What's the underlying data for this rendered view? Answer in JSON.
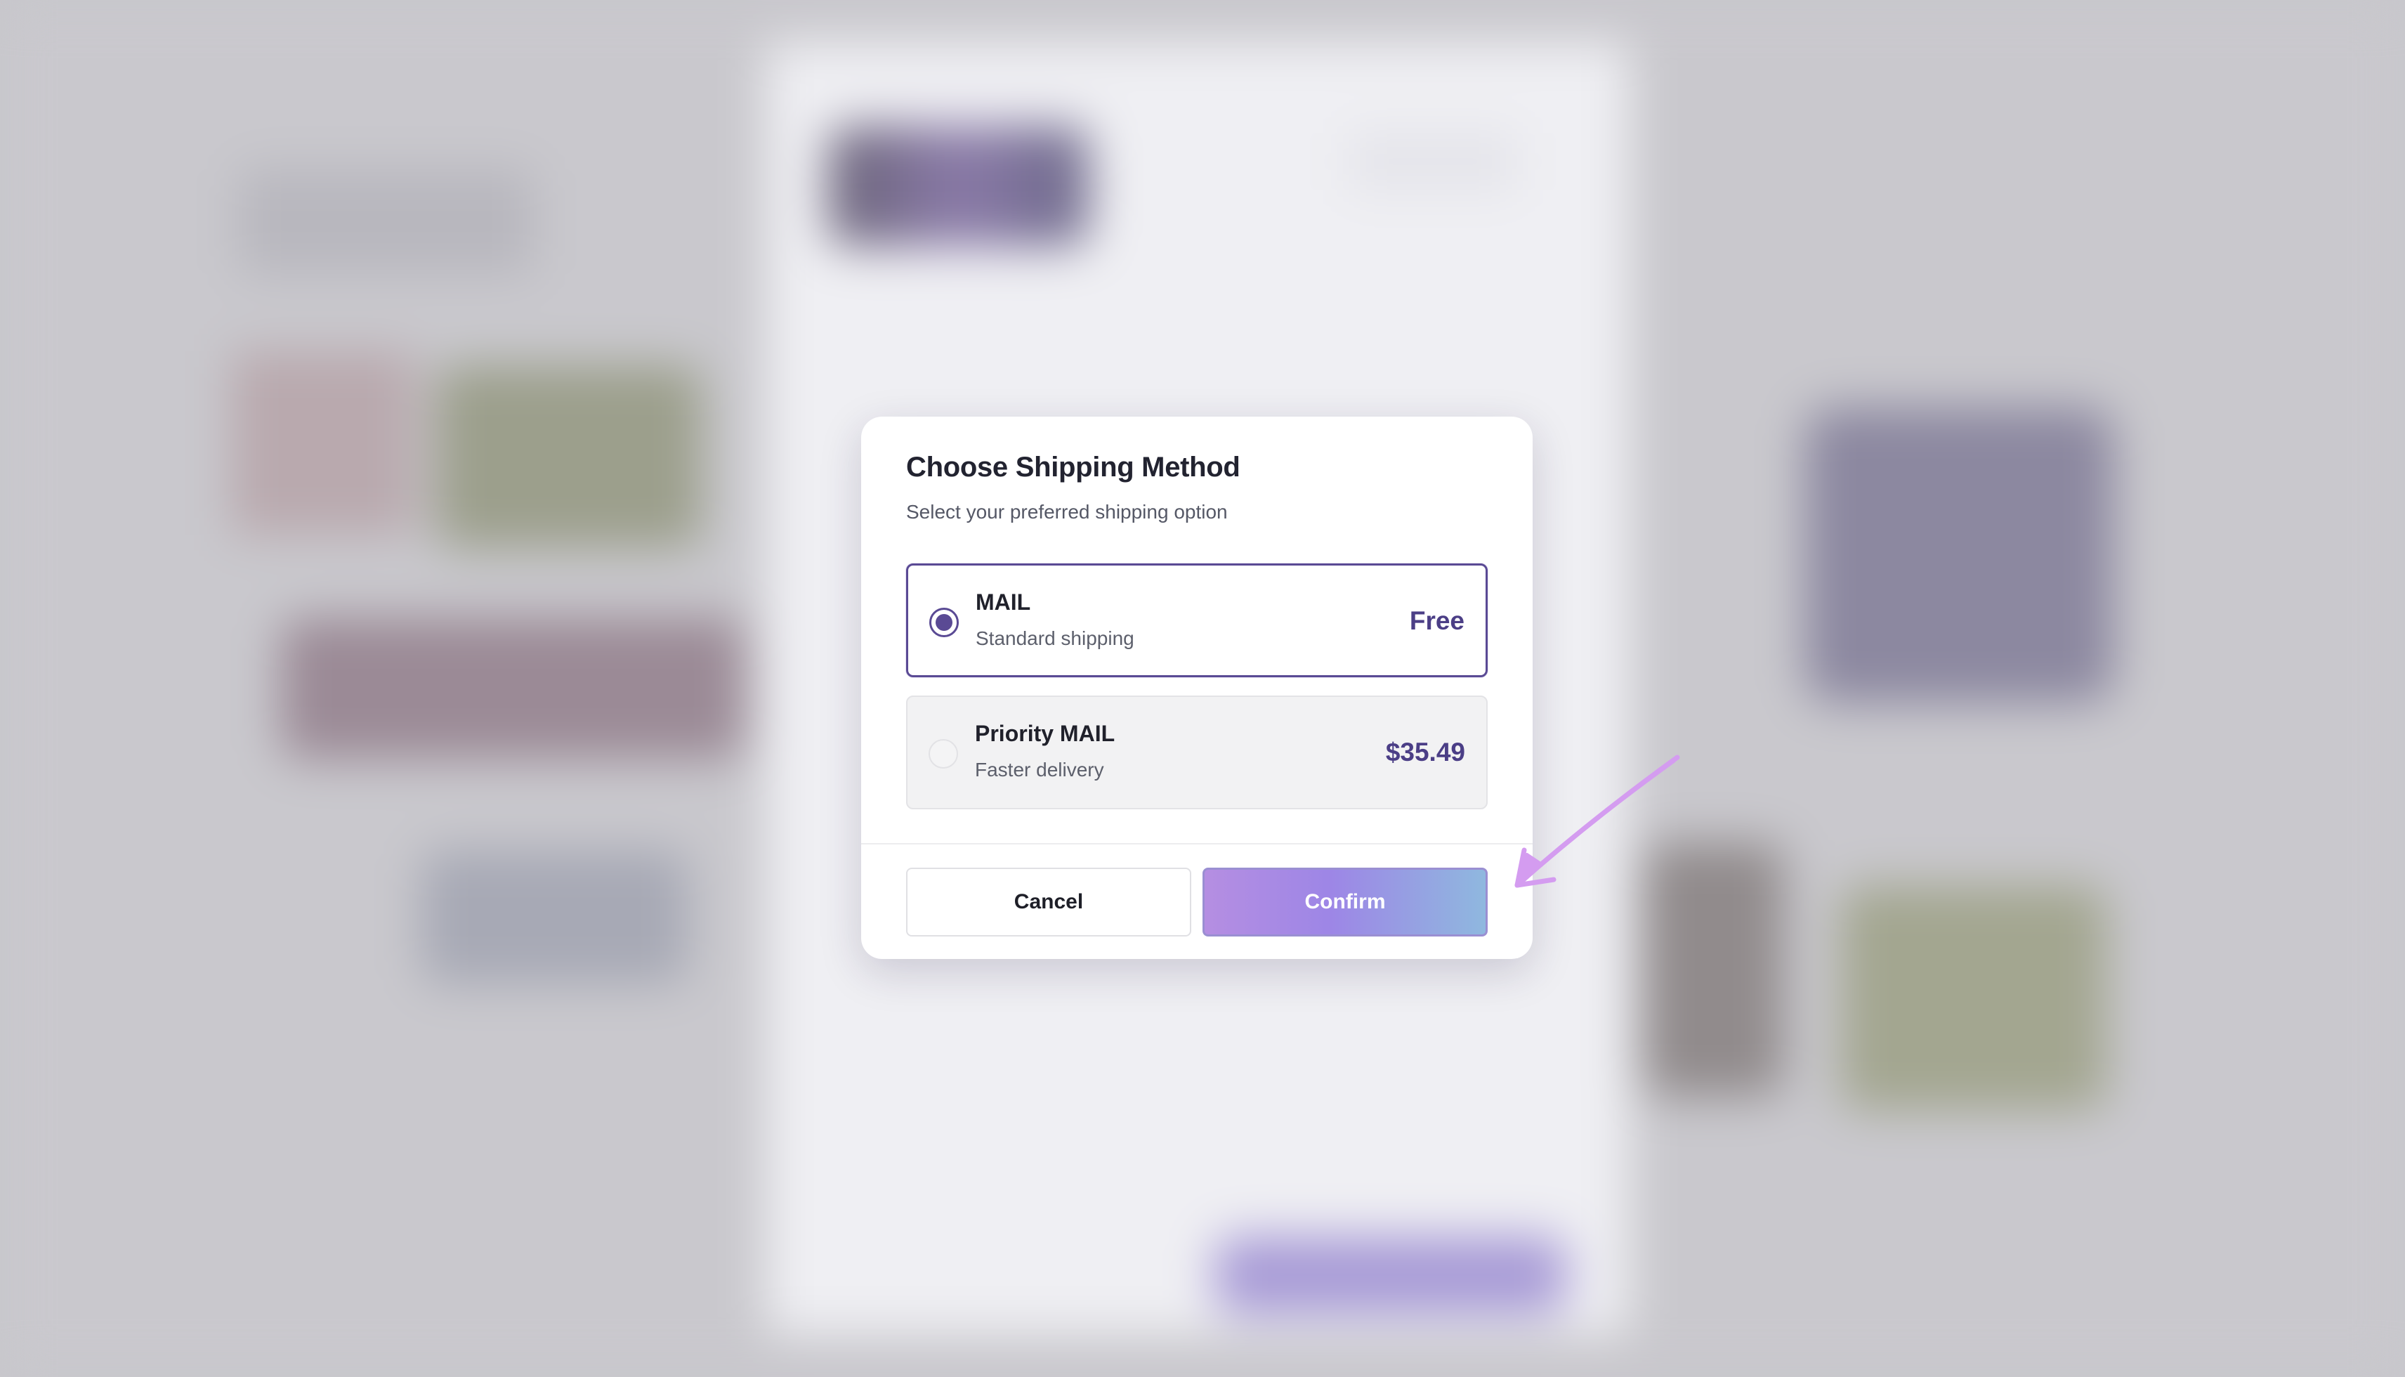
{
  "dialog": {
    "title": "Choose Shipping Method",
    "subtitle": "Select your preferred shipping option",
    "options": [
      {
        "name": "MAIL",
        "description": "Standard shipping",
        "price": "Free",
        "selected": true
      },
      {
        "name": "Priority MAIL",
        "description": "Faster delivery",
        "price": "$35.49",
        "selected": false
      }
    ],
    "cancel_label": "Cancel",
    "confirm_label": "Confirm"
  },
  "colors": {
    "accent": "#5a4a94",
    "price": "#4b3e86",
    "confirm_gradient_start": "#b58ee2",
    "confirm_gradient_end": "#8fb8df",
    "annotation_arrow": "#d49cf0"
  },
  "icons": {
    "selected_radio": "radio-selected-icon",
    "unselected_radio": "radio-unselected-icon",
    "annotation": "arrow-icon"
  }
}
